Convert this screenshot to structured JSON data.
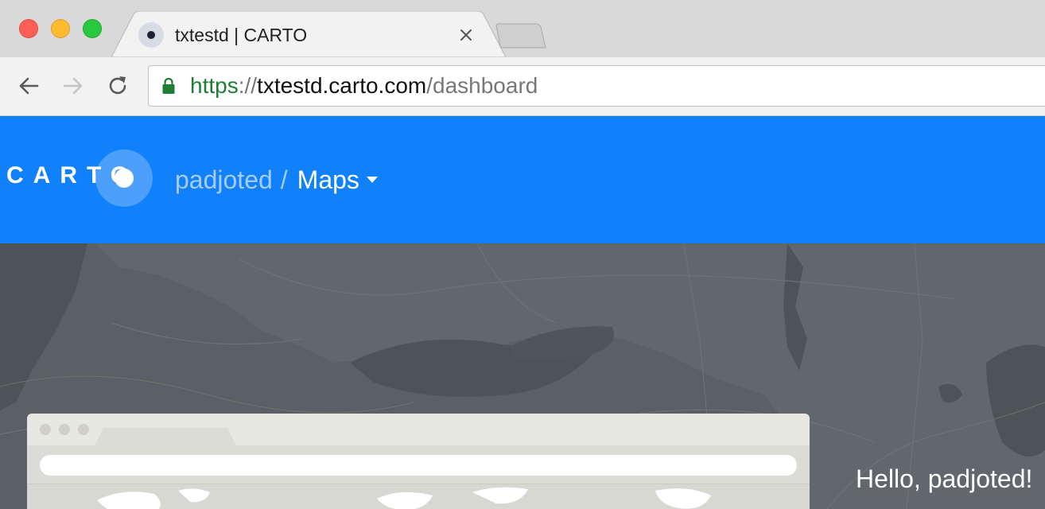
{
  "browser": {
    "tab_title": "txtestd | CARTO",
    "url": {
      "scheme": "https",
      "separator": "://",
      "host": "txtestd.carto.com",
      "path": "/dashboard"
    },
    "icons": {
      "close": "close-icon",
      "back": "back-arrow-icon",
      "forward": "forward-arrow-icon",
      "reload": "reload-icon",
      "secure": "lock-icon"
    },
    "colors": {
      "traffic_close": "#fc5f57",
      "traffic_minimize": "#fdbc2e",
      "traffic_maximize": "#28c840",
      "secure_url": "#1e7e34"
    }
  },
  "header": {
    "logo_text": "CARTO",
    "breadcrumb": {
      "user": "padjoted",
      "separator": "/",
      "section": "Maps"
    },
    "brand_color": "#1181fb"
  },
  "hero": {
    "greeting": "Hello, padjoted!"
  }
}
